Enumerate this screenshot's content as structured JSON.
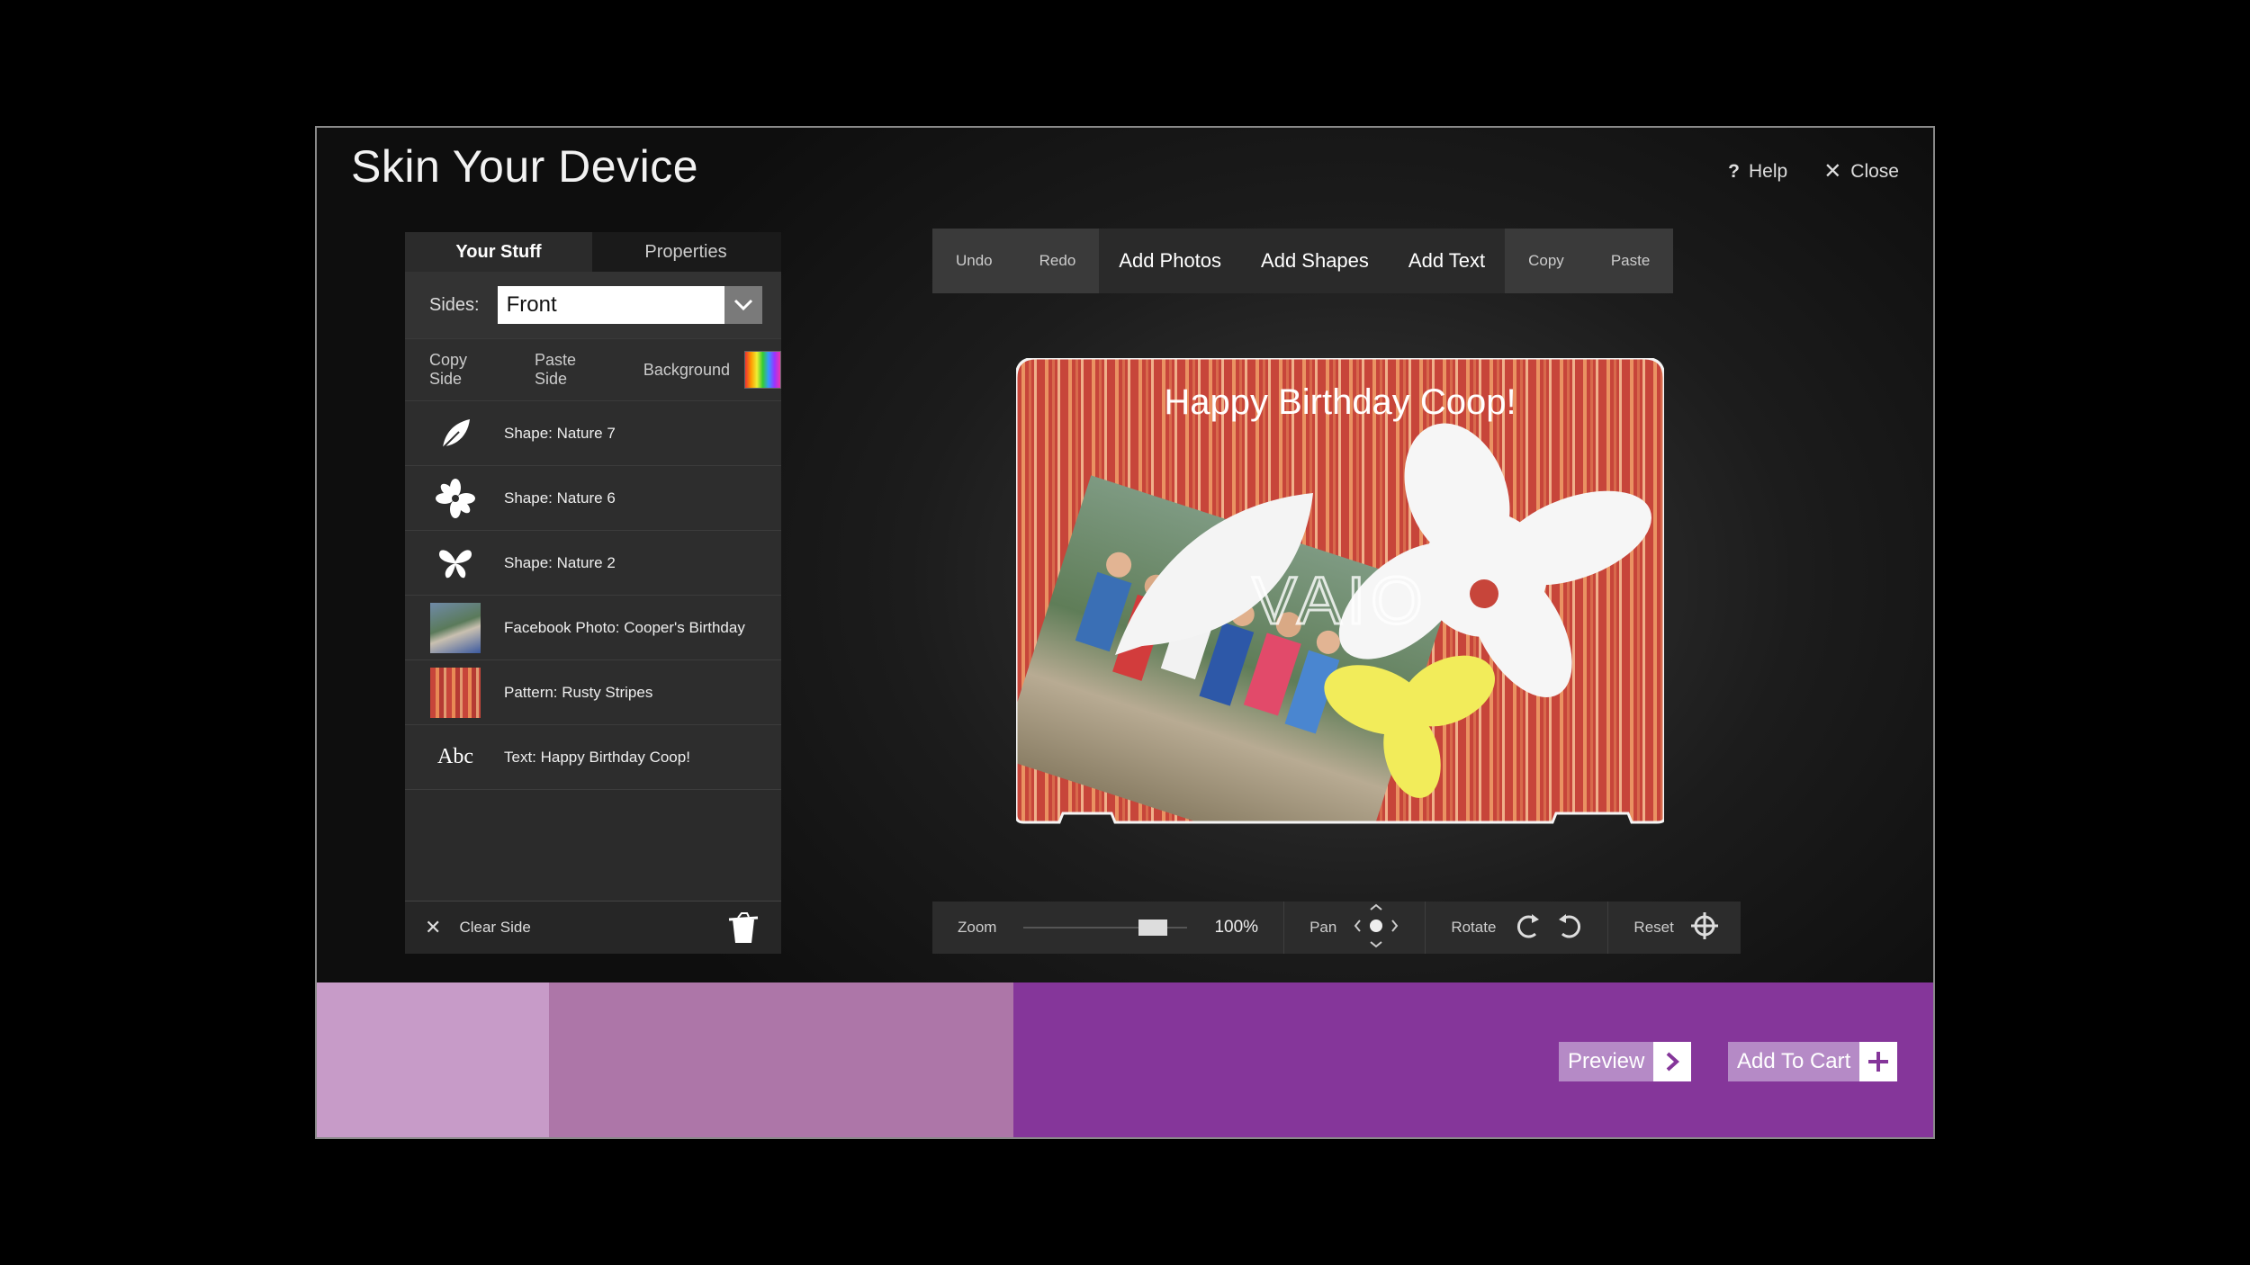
{
  "header": {
    "title": "Skin Your Device",
    "help_label": "Help",
    "close_label": "Close"
  },
  "panel": {
    "tabs": [
      {
        "label": "Your Stuff",
        "active": true
      },
      {
        "label": "Properties",
        "active": false
      }
    ],
    "sides_label": "Sides:",
    "sides_value": "Front",
    "tools": {
      "copy_side": "Copy Side",
      "paste_side": "Paste Side",
      "background": "Background"
    },
    "items": [
      {
        "label": "Shape: Nature 7",
        "icon": "leaf-icon"
      },
      {
        "label": "Shape: Nature 6",
        "icon": "flower-icon"
      },
      {
        "label": "Shape: Nature 2",
        "icon": "butterfly-icon"
      },
      {
        "label": "Facebook Photo: Cooper's Birthday",
        "icon": "photo-thumbnail"
      },
      {
        "label": "Pattern: Rusty Stripes",
        "icon": "pattern-thumbnail"
      },
      {
        "label": "Text: Happy Birthday Coop!",
        "icon": "text-icon",
        "icon_text": "Abc"
      }
    ],
    "clear_side_label": "Clear Side"
  },
  "toolbar": {
    "undo": "Undo",
    "redo": "Redo",
    "add_photos": "Add Photos",
    "add_shapes": "Add Shapes",
    "add_text": "Add Text",
    "copy": "Copy",
    "paste": "Paste"
  },
  "canvas": {
    "text": "Happy Birthday Coop!",
    "logo_text": "VAIO"
  },
  "controls": {
    "zoom_label": "Zoom",
    "zoom_value": "100%",
    "zoom_fraction": 0.85,
    "pan_label": "Pan",
    "rotate_label": "Rotate",
    "reset_label": "Reset"
  },
  "footer": {
    "preview_label": "Preview",
    "add_to_cart_label": "Add To Cart"
  },
  "colors": {
    "stripe_primary": "#c7453a",
    "footer_purple": "#85369a",
    "footer_mauve": "#ad76a8",
    "footer_lilac": "#c79bc8"
  }
}
